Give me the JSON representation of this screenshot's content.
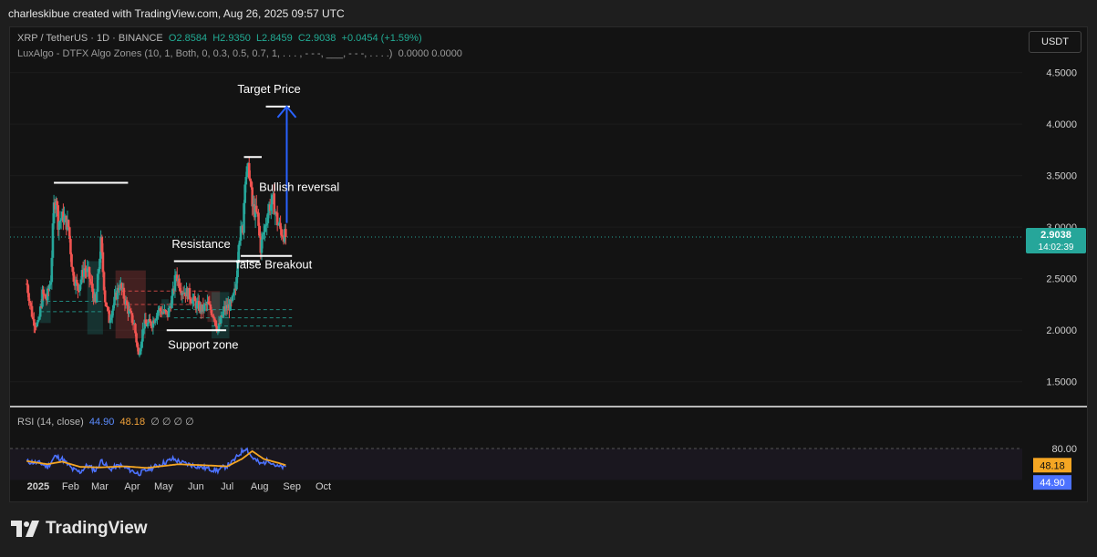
{
  "header": {
    "attribution": "charleskibue created with TradingView.com, Aug 26, 2025 09:57 UTC"
  },
  "legend": {
    "symbol": "XRP / TetherUS · 1D · BINANCE",
    "open": "O2.8584",
    "high": "H2.9350",
    "low": "L2.8459",
    "close": "C2.9038",
    "change": "+0.0454 (+1.59%)",
    "indicator": "LuxAlgo - DTFX Algo Zones (10, 1, Both, 0, 0.3, 0.5, 0.7, 1, . . . , - - -, ___, - - -, . . . .)",
    "indicator_values": "0.0000  0.0000"
  },
  "currency_button": "USDT",
  "price_tag": {
    "price": "2.9038",
    "countdown": "14:02:39"
  },
  "rsi_legend": {
    "label": "RSI (14, close)",
    "rsi": "44.90",
    "ma": "48.18",
    "rest": "∅ ∅ ∅ ∅"
  },
  "rsi_tags": {
    "upper": "80.00",
    "ma": "48.18",
    "rsi": "44.90"
  },
  "footer": {
    "brand": "TradingView"
  },
  "colors": {
    "up": "#26a69a",
    "down": "#ef5350",
    "rsi_line": "#4c72ff",
    "rsi_ma": "#f5a623",
    "arrow": "#2962ff",
    "bg": "#131313"
  },
  "chart_data": {
    "type": "candlestick",
    "title": "XRP / TetherUS · 1D · BINANCE",
    "ylim": [
      1.25,
      4.85
    ],
    "y_ticks": [
      "4.5000",
      "4.0000",
      "3.5000",
      "3.0000",
      "2.5000",
      "2.0000",
      "1.5000"
    ],
    "x_ticks": [
      "2025",
      "Feb",
      "Mar",
      "Apr",
      "May",
      "Jun",
      "Jul",
      "Aug",
      "Sep",
      "Oct"
    ],
    "price_path": [
      [
        "2024-12-21",
        2.45
      ],
      [
        "2024-12-27",
        2.1
      ],
      [
        "2025-01-01",
        2.05
      ],
      [
        "2025-01-05",
        2.35
      ],
      [
        "2025-01-09",
        2.3
      ],
      [
        "2025-01-13",
        2.5
      ],
      [
        "2025-01-16",
        3.2
      ],
      [
        "2025-01-18",
        3.3
      ],
      [
        "2025-01-20",
        3.05
      ],
      [
        "2025-01-25",
        3.1
      ],
      [
        "2025-01-30",
        3.0
      ],
      [
        "2025-02-03",
        2.55
      ],
      [
        "2025-02-08",
        2.4
      ],
      [
        "2025-02-14",
        2.6
      ],
      [
        "2025-02-18",
        2.55
      ],
      [
        "2025-02-25",
        2.25
      ],
      [
        "2025-03-02",
        2.85
      ],
      [
        "2025-03-06",
        2.3
      ],
      [
        "2025-03-10",
        2.1
      ],
      [
        "2025-03-17",
        2.35
      ],
      [
        "2025-03-20",
        2.45
      ],
      [
        "2025-03-28",
        2.2
      ],
      [
        "2025-04-03",
        2.05
      ],
      [
        "2025-04-07",
        1.75
      ],
      [
        "2025-04-12",
        2.05
      ],
      [
        "2025-04-20",
        2.07
      ],
      [
        "2025-04-26",
        2.2
      ],
      [
        "2025-05-05",
        2.15
      ],
      [
        "2025-05-10",
        2.35
      ],
      [
        "2025-05-13",
        2.55
      ],
      [
        "2025-05-18",
        2.4
      ],
      [
        "2025-05-25",
        2.35
      ],
      [
        "2025-06-01",
        2.25
      ],
      [
        "2025-06-07",
        2.2
      ],
      [
        "2025-06-12",
        2.25
      ],
      [
        "2025-06-18",
        2.15
      ],
      [
        "2025-06-22",
        2.0
      ],
      [
        "2025-06-28",
        2.2
      ],
      [
        "2025-07-05",
        2.25
      ],
      [
        "2025-07-09",
        2.4
      ],
      [
        "2025-07-12",
        2.9
      ],
      [
        "2025-07-16",
        3.0
      ],
      [
        "2025-07-18",
        3.5
      ],
      [
        "2025-07-22",
        3.55
      ],
      [
        "2025-07-25",
        3.2
      ],
      [
        "2025-07-30",
        3.1
      ],
      [
        "2025-08-02",
        2.8
      ],
      [
        "2025-08-06",
        3.0
      ],
      [
        "2025-08-10",
        3.2
      ],
      [
        "2025-08-14",
        3.25
      ],
      [
        "2025-08-18",
        3.05
      ],
      [
        "2025-08-22",
        2.95
      ],
      [
        "2025-08-26",
        2.9038
      ]
    ],
    "horizontal_levels": [
      {
        "price": 3.43,
        "from": "2025-01-16",
        "to": "2025-03-28"
      },
      {
        "price": 2.67,
        "from": "2025-05-11",
        "to": "2025-08-01"
      },
      {
        "price": 2.0,
        "from": "2025-05-04",
        "to": "2025-06-30"
      },
      {
        "price": 3.68,
        "from": "2025-07-17",
        "to": "2025-08-03"
      },
      {
        "price": 2.72,
        "from": "2025-07-14",
        "to": "2025-09-01"
      },
      {
        "price": 4.17,
        "from": "2025-08-07",
        "to": "2025-08-30"
      }
    ],
    "annotations": [
      {
        "text": "Target Price",
        "date": "2025-08-10",
        "price": 4.3
      },
      {
        "text": "Resistance",
        "date": "2025-06-06",
        "price": 2.8
      },
      {
        "text": "Support zone",
        "date": "2025-06-08",
        "price": 1.82
      },
      {
        "text": "false Breakout",
        "date": "2025-08-15",
        "price": 2.6
      },
      {
        "text": "Bullish reversal",
        "date": "2025-09-08",
        "price": 3.35
      }
    ],
    "arrow": {
      "date": "2025-08-27",
      "from": 3.04,
      "to": 4.17
    },
    "zones": [
      {
        "color": "#26a69a",
        "from": "2025-01-03",
        "to": "2025-01-13",
        "top": 2.42,
        "bottom": 2.07
      },
      {
        "color": "#26a69a",
        "from": "2025-02-17",
        "to": "2025-03-04",
        "top": 2.67,
        "bottom": 1.96
      },
      {
        "color": "#ef5350",
        "from": "2025-03-16",
        "to": "2025-04-14",
        "top": 2.58,
        "bottom": 1.92
      },
      {
        "color": "#26a69a",
        "from": "2025-04-29",
        "to": "2025-05-06",
        "top": 2.3,
        "bottom": 2.12
      },
      {
        "color": "#ef5350",
        "from": "2025-06-12",
        "to": "2025-06-24",
        "top": 2.38,
        "bottom": 2.08
      },
      {
        "color": "#26a69a",
        "from": "2025-06-16",
        "to": "2025-07-03",
        "top": 2.37,
        "bottom": 1.92
      }
    ],
    "dashed_levels": [
      {
        "price": 2.2,
        "from": "2025-05-11",
        "to": "2025-09-01",
        "color": "#26a69a"
      },
      {
        "price": 2.12,
        "from": "2025-05-11",
        "to": "2025-09-01",
        "color": "#26a69a"
      },
      {
        "price": 2.04,
        "from": "2025-06-16",
        "to": "2025-09-01",
        "color": "#26a69a"
      },
      {
        "price": 2.38,
        "from": "2025-03-16",
        "to": "2025-06-12",
        "color": "#ef5350"
      },
      {
        "price": 2.25,
        "from": "2025-03-16",
        "to": "2025-06-12",
        "color": "#ef5350"
      },
      {
        "price": 2.28,
        "from": "2025-01-03",
        "to": "2025-03-04",
        "color": "#26a69a"
      },
      {
        "price": 2.18,
        "from": "2025-01-03",
        "to": "2025-03-04",
        "color": "#26a69a"
      }
    ],
    "rsi": {
      "ylim": [
        0,
        100
      ],
      "level_upper": 80,
      "rsi_path": [
        [
          "2024-12-21",
          55
        ],
        [
          "2025-01-03",
          52
        ],
        [
          "2025-01-10",
          45
        ],
        [
          "2025-01-17",
          65
        ],
        [
          "2025-01-24",
          60
        ],
        [
          "2025-02-03",
          40
        ],
        [
          "2025-02-10",
          35
        ],
        [
          "2025-02-17",
          48
        ],
        [
          "2025-02-25",
          38
        ],
        [
          "2025-03-03",
          58
        ],
        [
          "2025-03-10",
          40
        ],
        [
          "2025-03-20",
          48
        ],
        [
          "2025-04-07",
          32
        ],
        [
          "2025-04-20",
          43
        ],
        [
          "2025-05-10",
          60
        ],
        [
          "2025-05-20",
          52
        ],
        [
          "2025-06-05",
          45
        ],
        [
          "2025-06-22",
          38
        ],
        [
          "2025-07-05",
          52
        ],
        [
          "2025-07-14",
          72
        ],
        [
          "2025-07-19",
          82
        ],
        [
          "2025-07-24",
          65
        ],
        [
          "2025-08-02",
          50
        ],
        [
          "2025-08-10",
          58
        ],
        [
          "2025-08-18",
          45
        ],
        [
          "2025-08-26",
          44.9
        ]
      ],
      "ma_path": [
        [
          "2024-12-21",
          56
        ],
        [
          "2025-01-10",
          50
        ],
        [
          "2025-01-24",
          55
        ],
        [
          "2025-02-10",
          45
        ],
        [
          "2025-03-01",
          44
        ],
        [
          "2025-03-25",
          46
        ],
        [
          "2025-04-15",
          43
        ],
        [
          "2025-05-15",
          50
        ],
        [
          "2025-06-10",
          48
        ],
        [
          "2025-07-01",
          46
        ],
        [
          "2025-07-15",
          60
        ],
        [
          "2025-07-25",
          75
        ],
        [
          "2025-08-05",
          60
        ],
        [
          "2025-08-20",
          52
        ],
        [
          "2025-08-26",
          48.18
        ]
      ]
    }
  }
}
